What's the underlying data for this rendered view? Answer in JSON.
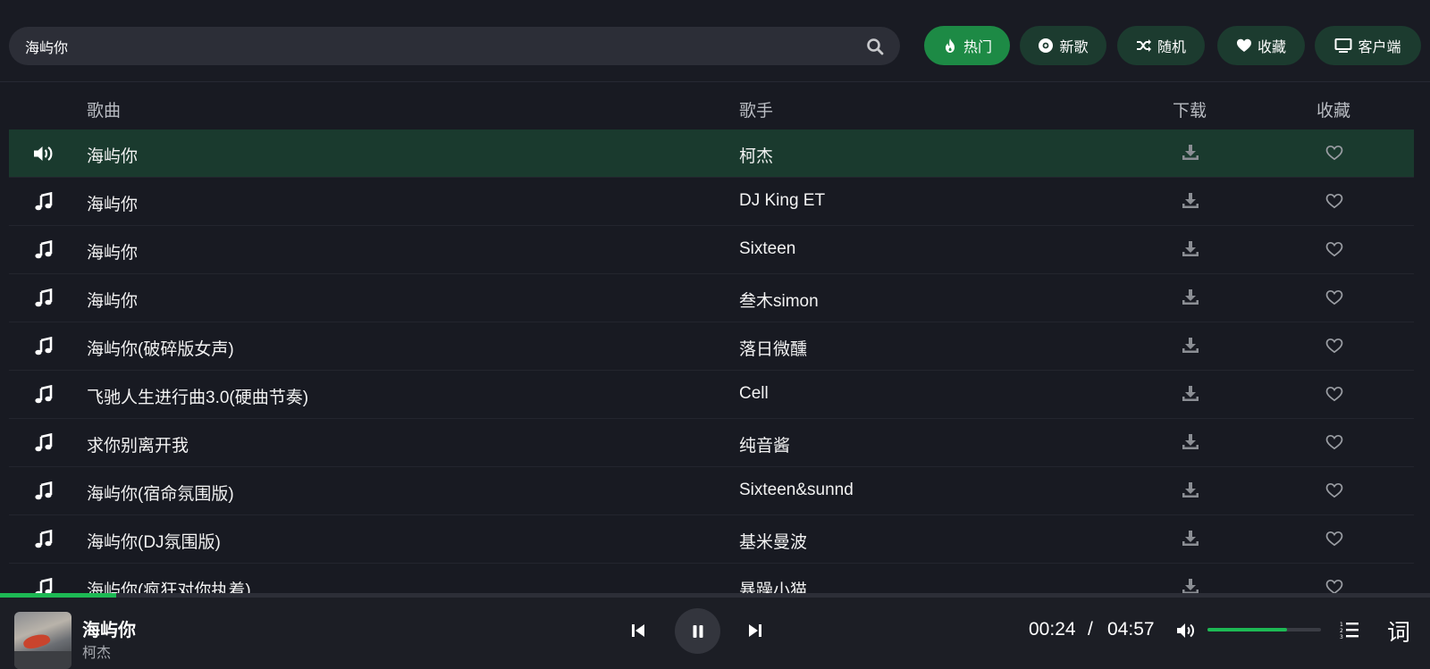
{
  "search": {
    "value": "海屿你",
    "icon": "search-icon"
  },
  "nav": [
    {
      "label": "热门",
      "icon": "fire-icon",
      "active": true
    },
    {
      "label": "新歌",
      "icon": "disc-icon",
      "active": false
    },
    {
      "label": "随机",
      "icon": "shuffle-icon",
      "active": false
    },
    {
      "label": "收藏",
      "icon": "heart-icon",
      "active": false
    },
    {
      "label": "客户端",
      "icon": "monitor-icon",
      "active": false
    }
  ],
  "table": {
    "headers": {
      "song": "歌曲",
      "artist": "歌手",
      "download": "下载",
      "favorite": "收藏"
    },
    "rows": [
      {
        "title": "海屿你",
        "artist": "柯杰",
        "playing": true
      },
      {
        "title": "海屿你",
        "artist": "DJ King ET",
        "playing": false
      },
      {
        "title": "海屿你",
        "artist": "Sixteen",
        "playing": false
      },
      {
        "title": "海屿你",
        "artist": "叁木simon",
        "playing": false
      },
      {
        "title": "海屿你(破碎版女声)",
        "artist": "落日微醺",
        "playing": false
      },
      {
        "title": "飞驰人生进行曲3.0(硬曲节奏)",
        "artist": "Cell",
        "playing": false
      },
      {
        "title": "求你别离开我",
        "artist": "纯音酱",
        "playing": false
      },
      {
        "title": "海屿你(宿命氛围版)",
        "artist": "Sixteen&sunnd",
        "playing": false
      },
      {
        "title": "海屿你(DJ氛围版)",
        "artist": "基米曼波",
        "playing": false
      },
      {
        "title": "海屿你(疯狂对你执着)",
        "artist": "暴躁小猫",
        "playing": false
      }
    ]
  },
  "player": {
    "title": "海屿你",
    "artist": "柯杰",
    "current_time": "00:24",
    "separator": "/",
    "total_time": "04:57",
    "progress": 0.081,
    "volume": 0.7,
    "lyric_label": "词"
  },
  "colors": {
    "accent": "#1db954",
    "active_button": "#1d8a45",
    "button": "#1c3b2f",
    "playing_row": "#1a3a2e",
    "background": "#181a22"
  }
}
